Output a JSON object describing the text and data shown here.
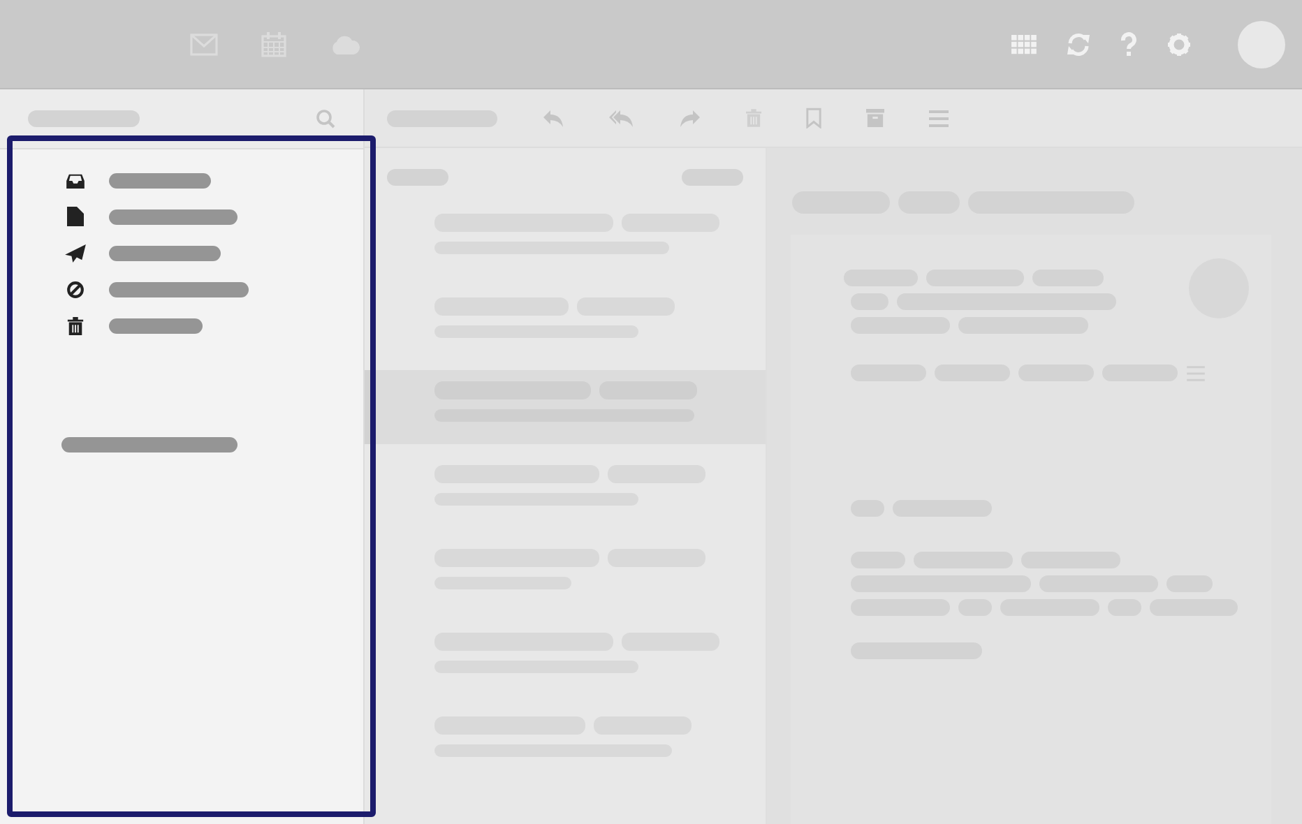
{
  "top_bar": {
    "apps": [
      {
        "kind": "mail"
      },
      {
        "kind": "calendar"
      },
      {
        "kind": "cloud"
      }
    ],
    "tools": [
      {
        "kind": "grid"
      },
      {
        "kind": "refresh"
      },
      {
        "kind": "help"
      },
      {
        "kind": "settings"
      }
    ]
  },
  "sidebar": {
    "highlighted": true,
    "folders": [
      {
        "kind": "inbox"
      },
      {
        "kind": "drafts"
      },
      {
        "kind": "sent"
      },
      {
        "kind": "spam"
      },
      {
        "kind": "trash"
      }
    ]
  },
  "toolbar": {
    "actions": [
      {
        "kind": "reply"
      },
      {
        "kind": "reply_all"
      },
      {
        "kind": "forward"
      },
      {
        "kind": "trash"
      },
      {
        "kind": "bookmark"
      },
      {
        "kind": "archive"
      },
      {
        "kind": "menu"
      }
    ]
  },
  "messages": [
    {
      "selected": false
    },
    {
      "selected": false
    },
    {
      "selected": true
    },
    {
      "selected": false
    },
    {
      "selected": false
    },
    {
      "selected": false
    },
    {
      "selected": false
    }
  ]
}
